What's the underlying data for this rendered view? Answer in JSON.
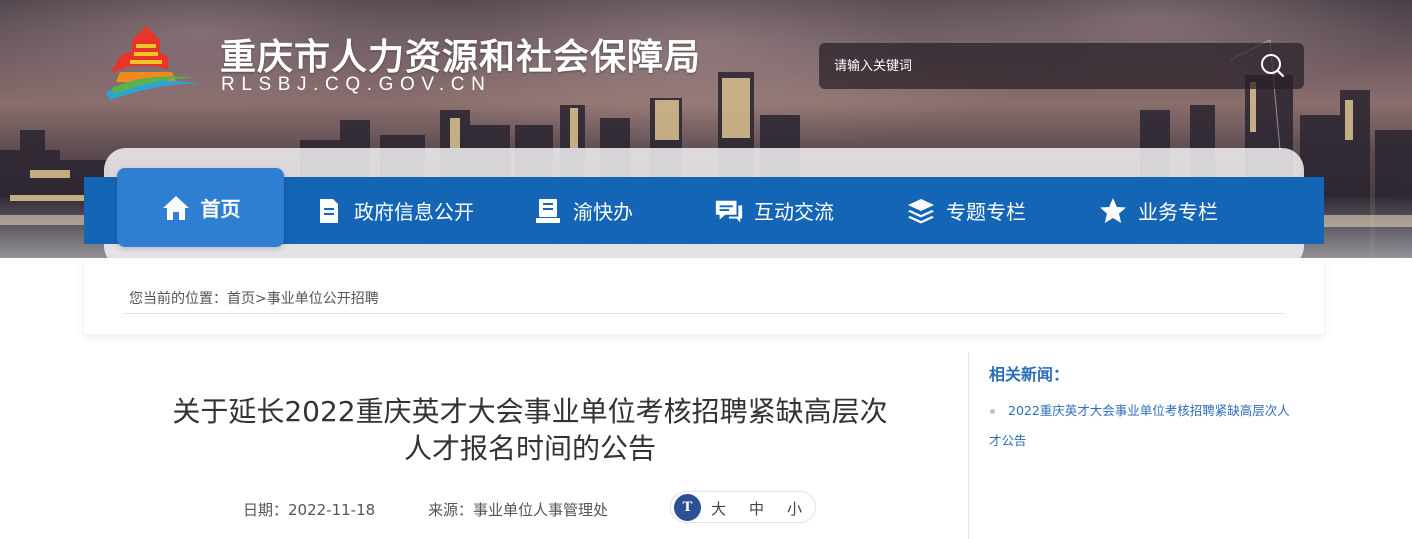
{
  "header": {
    "site_title": "重庆市人力资源和社会保障局",
    "site_domain": "RLSBJ.CQ.GOV.CN",
    "logo_icon": "chongqing-logo-icon"
  },
  "search": {
    "placeholder": "请输入关键词",
    "icon": "search-icon"
  },
  "nav": {
    "items": [
      {
        "label": "首页",
        "icon": "home-icon",
        "active": true
      },
      {
        "label": "政府信息公开",
        "icon": "document-icon",
        "active": false
      },
      {
        "label": "渝快办",
        "icon": "book-icon",
        "active": false
      },
      {
        "label": "互动交流",
        "icon": "chat-icon",
        "active": false
      },
      {
        "label": "专题专栏",
        "icon": "layers-icon",
        "active": false
      },
      {
        "label": "业务专栏",
        "icon": "star-icon",
        "active": false
      }
    ]
  },
  "breadcrumb": {
    "prefix": "您当前的位置：",
    "home": "首页",
    "separator": ">",
    "current": "事业单位公开招聘"
  },
  "article": {
    "title_line1": "关于延长2022重庆英才大会事业单位考核招聘紧缺高层次",
    "title_line2": "人才报名时间的公告",
    "date": "日期：2022-11-18",
    "source": "来源：事业单位人事管理处",
    "font_size": {
      "icon_text": "T",
      "large": "大",
      "medium": "中",
      "small": "小"
    }
  },
  "sidebar": {
    "title": "相关新闻：",
    "links": [
      "2022重庆英才大会事业单位考核招聘紧缺高层次人才公告"
    ]
  },
  "colors": {
    "nav_blue": "#1565b7",
    "nav_active": "#2e7fd1",
    "link_blue": "#2c6db8"
  }
}
